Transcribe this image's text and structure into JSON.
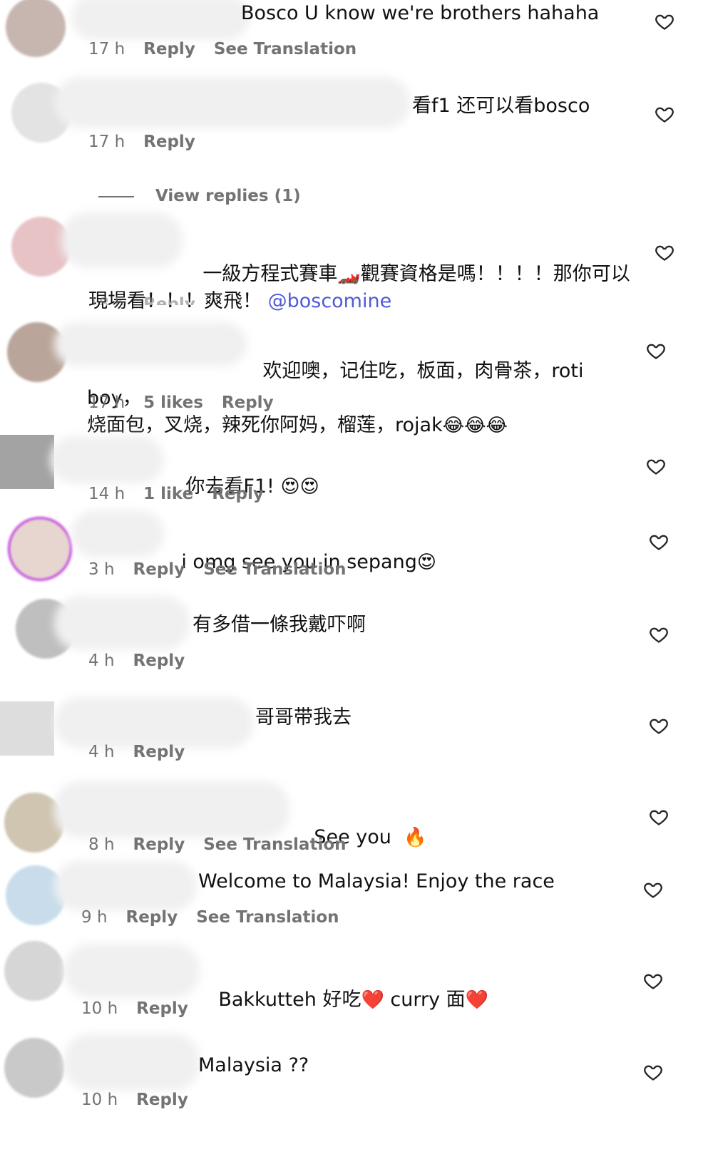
{
  "comments": [
    {
      "text": "Bosco U know we're brothers hahaha",
      "time": "17 h",
      "likes": "",
      "reply": "Reply",
      "translation": "See Translation"
    },
    {
      "text": "看f1 还可以看bosco",
      "time": "17 h",
      "likes": "",
      "reply": "Reply",
      "translation": ""
    },
    {
      "text_a": "一級方程式賽車",
      "text_b": "觀賽資格是嗎！！！！那你可以",
      "text_c": "現場看！！！爽飛！ ",
      "mention": "@boscomine",
      "time": "18 h",
      "likes": "",
      "reply": "Reply",
      "translation": ""
    },
    {
      "text_a": "欢迎噢，记住吃，板面，肉骨茶，roti boy，",
      "text_b": "烧面包，叉烧，辣死你阿妈，榴莲，rojak",
      "emojis": "😂😂😂",
      "time": "17 h",
      "likes": "5 likes",
      "reply": "Reply",
      "translation": ""
    },
    {
      "text": "你去看F1!",
      "emojis": "😍😍",
      "time": "14 h",
      "likes": "1 like",
      "reply": "Reply",
      "translation": ""
    },
    {
      "text": "i omg see you in sepang",
      "emojis": "😍",
      "time": "3 h",
      "likes": "",
      "reply": "Reply",
      "translation": "See Translation"
    },
    {
      "text": "有多借一條我戴吓啊",
      "time": "4 h",
      "likes": "",
      "reply": "Reply",
      "translation": ""
    },
    {
      "text": "哥哥带我去",
      "time": "4 h",
      "likes": "",
      "reply": "Reply",
      "translation": ""
    },
    {
      "text": "See you",
      "emojis": "🔥",
      "time": "8 h",
      "likes": "",
      "reply": "Reply",
      "translation": "See Translation"
    },
    {
      "text": "Welcome to Malaysia! Enjoy the race",
      "time": "9 h",
      "likes": "",
      "reply": "Reply",
      "translation": "See Translation"
    },
    {
      "text_a": "Bakkutteh 好吃",
      "emoji_a": "❤️",
      "text_b": " curry 面",
      "emoji_b": "❤️",
      "time": "10 h",
      "likes": "",
      "reply": "Reply",
      "translation": ""
    },
    {
      "text": "Malaysia ??",
      "time": "10 h",
      "likes": "",
      "reply": "Reply",
      "translation": ""
    }
  ],
  "view_replies": "View replies (1)",
  "icons": {
    "like": "heart-outline-icon"
  },
  "colors": {
    "meta": "#737373",
    "mention": "#4f5bd5",
    "text": "#111111"
  }
}
